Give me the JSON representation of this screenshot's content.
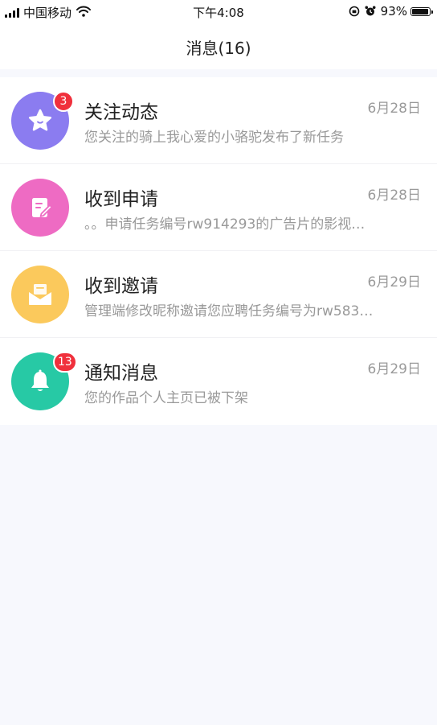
{
  "status_bar": {
    "carrier": "中国移动",
    "time": "下午4:08",
    "battery": "93%",
    "battery_level": 0.93
  },
  "header": {
    "title": "消息(16)"
  },
  "messages": [
    {
      "title": "关注动态",
      "date": "6月28日",
      "preview": "您关注的骑上我心爱的小骆驼发布了新任务",
      "badge": "3",
      "icon": "star-icon",
      "color": "#8b7cf0"
    },
    {
      "title": "收到申请",
      "date": "6月28日",
      "preview": "。。申请任务编号rw914293的广告片的影视…",
      "badge": "",
      "icon": "edit-document-icon",
      "color": "#ee6bc3"
    },
    {
      "title": "收到邀请",
      "date": "6月29日",
      "preview": "管理端修改昵称邀请您应聘任务编号为rw583…",
      "badge": "",
      "icon": "mail-icon",
      "color": "#fbc95c"
    },
    {
      "title": "通知消息",
      "date": "6月29日",
      "preview": "您的作品个人主页已被下架",
      "badge": "13",
      "icon": "bell-icon",
      "color": "#27c9a5"
    }
  ]
}
